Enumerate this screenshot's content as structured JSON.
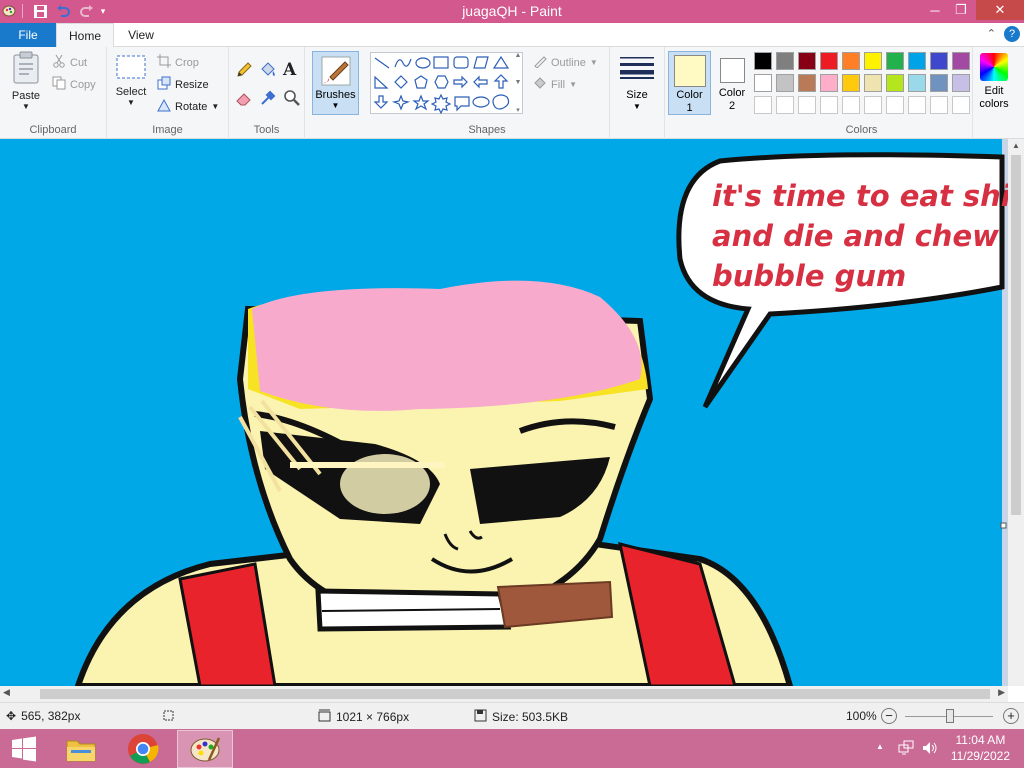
{
  "window": {
    "title": "juagaQH - Paint"
  },
  "tabs": {
    "file": "File",
    "home": "Home",
    "view": "View"
  },
  "clipboard": {
    "paste": "Paste",
    "cut": "Cut",
    "copy": "Copy",
    "label": "Clipboard"
  },
  "image": {
    "select": "Select",
    "crop": "Crop",
    "resize": "Resize",
    "rotate": "Rotate",
    "label": "Image"
  },
  "tools": {
    "label": "Tools"
  },
  "brushes": {
    "label": "Brushes"
  },
  "shapes": {
    "outline": "Outline",
    "fill": "Fill",
    "label": "Shapes"
  },
  "size": {
    "label": "Size"
  },
  "color1": {
    "label_a": "Color",
    "label_b": "1",
    "value": "#fff9c3"
  },
  "color2": {
    "label_a": "Color",
    "label_b": "2",
    "value": "#ffffff"
  },
  "colors": {
    "label": "Colors",
    "edit_a": "Edit",
    "edit_b": "colors",
    "row1": [
      "#000000",
      "#7f7f7f",
      "#880015",
      "#ed1c24",
      "#ff7f27",
      "#fff200",
      "#22b14c",
      "#00a2e8",
      "#3f48cc",
      "#a349a4"
    ],
    "row2": [
      "#ffffff",
      "#c3c3c3",
      "#b97a57",
      "#ffaec9",
      "#ffc90e",
      "#efe4b0",
      "#b5e61d",
      "#99d9ea",
      "#7092be",
      "#c8bfe7"
    ],
    "row3": [
      "#ffffff",
      "#ffffff",
      "#ffffff",
      "#ffffff",
      "#ffffff",
      "#ffffff",
      "#ffffff",
      "#ffffff",
      "#ffffff",
      "#ffffff"
    ]
  },
  "canvas": {
    "speech_line1": "it's time to eat shi",
    "speech_line2": "and die and chew",
    "speech_line3": "bubble gum"
  },
  "status": {
    "cursor": "565, 382px",
    "dimensions": "1021 × 766px",
    "size": "Size: 503.5KB",
    "zoom": "100%"
  },
  "taskbar": {
    "time": "11:04 AM",
    "date": "11/29/2022"
  }
}
